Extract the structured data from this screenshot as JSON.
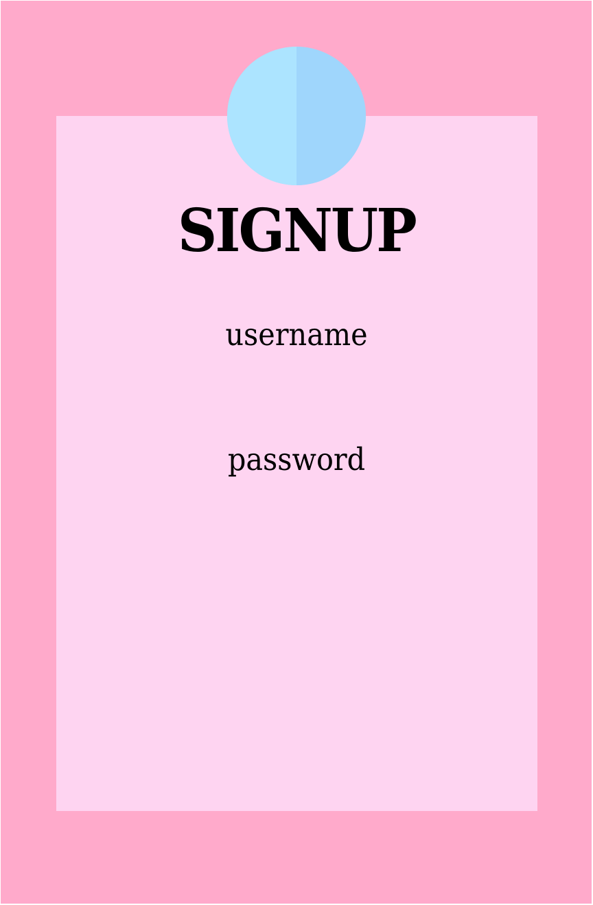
{
  "signup": {
    "title": "SIGNUP",
    "username_label": "username",
    "password_label": "password"
  },
  "colors": {
    "frame_background": "#ffaacb",
    "card_background": "#fed4f1",
    "avatar_left": "#ace4ff",
    "avatar_right": "#9fd6fc",
    "text": "#000000"
  },
  "icons": {
    "avatar": "avatar-circle-icon"
  }
}
